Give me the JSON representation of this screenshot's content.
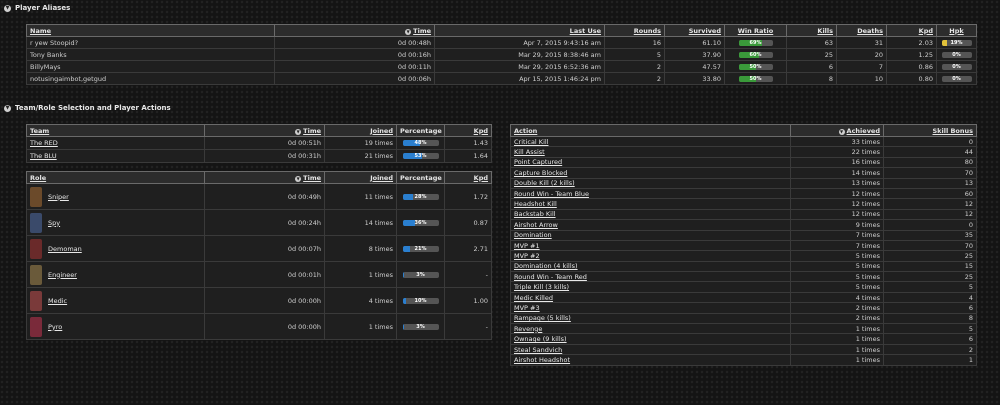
{
  "aliases": {
    "section_title": "Player Aliases",
    "headers": {
      "name": "Name",
      "time": "Time",
      "last_use": "Last Use",
      "rounds": "Rounds",
      "survived": "Survived",
      "win_ratio": "Win Ratio",
      "kills": "Kills",
      "deaths": "Deaths",
      "kpd": "Kpd",
      "hpk": "Hpk"
    },
    "rows": [
      {
        "name": "r yew Stoopid?",
        "time": "0d 00:48h",
        "last_use": "Apr 7, 2015 9:43:16 am",
        "rounds": "16",
        "survived": "61.10",
        "win_ratio": "69%",
        "win_ratio_value": 0.69,
        "kills": "63",
        "deaths": "31",
        "kpd": "2.03",
        "hpk": "19%",
        "hpk_value": 0.19
      },
      {
        "name": "Tony Banks",
        "time": "0d 00:16h",
        "last_use": "Mar 29, 2015 8:38:46 am",
        "rounds": "5",
        "survived": "37.90",
        "win_ratio": "60%",
        "win_ratio_value": 0.6,
        "kills": "25",
        "deaths": "20",
        "kpd": "1.25",
        "hpk": "0%",
        "hpk_value": 0
      },
      {
        "name": "BillyMays",
        "time": "0d 00:11h",
        "last_use": "Mar 29, 2015 6:52:36 am",
        "rounds": "2",
        "survived": "47.57",
        "win_ratio": "50%",
        "win_ratio_value": 0.5,
        "kills": "6",
        "deaths": "7",
        "kpd": "0.86",
        "hpk": "0%",
        "hpk_value": 0
      },
      {
        "name": "notusingaimbot,getgud",
        "time": "0d 00:06h",
        "last_use": "Apr 15, 2015 1:46:24 pm",
        "rounds": "2",
        "survived": "33.80",
        "win_ratio": "50%",
        "win_ratio_value": 0.5,
        "kills": "8",
        "deaths": "10",
        "kpd": "0.80",
        "hpk": "0%",
        "hpk_value": 0
      }
    ]
  },
  "team_section_title": "Team/Role Selection and Player Actions",
  "teams": {
    "headers": {
      "team": "Team",
      "time": "Time",
      "joined": "Joined",
      "percentage": "Percentage",
      "kpd": "Kpd"
    },
    "rows": [
      {
        "team": "The RED",
        "time": "0d 00:51h",
        "joined": "19 times",
        "percentage": "48%",
        "pct_value": 0.48,
        "kpd": "1.43"
      },
      {
        "team": "The BLU",
        "time": "0d 00:31h",
        "joined": "21 times",
        "percentage": "53%",
        "pct_value": 0.53,
        "kpd": "1.64"
      }
    ]
  },
  "roles": {
    "headers": {
      "role": "Role",
      "time": "Time",
      "joined": "Joined",
      "percentage": "Percentage",
      "kpd": "Kpd"
    },
    "rows": [
      {
        "role": "Sniper",
        "icon": "sniper-icon",
        "color": "#6b4a2a",
        "time": "0d 00:49h",
        "joined": "11 times",
        "percentage": "28%",
        "pct_value": 0.28,
        "kpd": "1.72"
      },
      {
        "role": "Spy",
        "icon": "spy-icon",
        "color": "#3a4a6a",
        "time": "0d 00:24h",
        "joined": "14 times",
        "percentage": "36%",
        "pct_value": 0.36,
        "kpd": "0.87"
      },
      {
        "role": "Demoman",
        "icon": "demoman-icon",
        "color": "#6a2a2a",
        "time": "0d 00:07h",
        "joined": "8 times",
        "percentage": "21%",
        "pct_value": 0.21,
        "kpd": "2.71"
      },
      {
        "role": "Engineer",
        "icon": "engineer-icon",
        "color": "#6a5a3a",
        "time": "0d 00:01h",
        "joined": "1 times",
        "percentage": "3%",
        "pct_value": 0.03,
        "kpd": "-"
      },
      {
        "role": "Medic",
        "icon": "medic-icon",
        "color": "#7a3a3a",
        "time": "0d 00:00h",
        "joined": "4 times",
        "percentage": "10%",
        "pct_value": 0.1,
        "kpd": "1.00"
      },
      {
        "role": "Pyro",
        "icon": "pyro-icon",
        "color": "#7a2a3a",
        "time": "0d 00:00h",
        "joined": "1 times",
        "percentage": "3%",
        "pct_value": 0.03,
        "kpd": "-"
      }
    ]
  },
  "actions": {
    "headers": {
      "action": "Action",
      "achieved": "Achieved",
      "skill_bonus": "Skill Bonus"
    },
    "rows": [
      {
        "action": "Critical Kill",
        "achieved": "33 times",
        "bonus": "0"
      },
      {
        "action": "Kill Assist",
        "achieved": "22 times",
        "bonus": "44"
      },
      {
        "action": "Point Captured",
        "achieved": "16 times",
        "bonus": "80"
      },
      {
        "action": "Capture Blocked",
        "achieved": "14 times",
        "bonus": "70"
      },
      {
        "action": "Double Kill (2 kills)",
        "achieved": "13 times",
        "bonus": "13"
      },
      {
        "action": "Round Win - Team Blue",
        "achieved": "12 times",
        "bonus": "60"
      },
      {
        "action": "Headshot Kill",
        "achieved": "12 times",
        "bonus": "12"
      },
      {
        "action": "Backstab Kill",
        "achieved": "12 times",
        "bonus": "12"
      },
      {
        "action": "Airshot Arrow",
        "achieved": "9 times",
        "bonus": "0"
      },
      {
        "action": "Domination",
        "achieved": "7 times",
        "bonus": "35"
      },
      {
        "action": "MVP #1",
        "achieved": "7 times",
        "bonus": "70"
      },
      {
        "action": "MVP #2",
        "achieved": "5 times",
        "bonus": "25"
      },
      {
        "action": "Domination (4 kills)",
        "achieved": "5 times",
        "bonus": "15"
      },
      {
        "action": "Round Win - Team Red",
        "achieved": "5 times",
        "bonus": "25"
      },
      {
        "action": "Triple Kill (3 kills)",
        "achieved": "5 times",
        "bonus": "5"
      },
      {
        "action": "Medic Killed",
        "achieved": "4 times",
        "bonus": "4"
      },
      {
        "action": "MVP #3",
        "achieved": "2 times",
        "bonus": "6"
      },
      {
        "action": "Rampage (5 kills)",
        "achieved": "2 times",
        "bonus": "8"
      },
      {
        "action": "Revenge",
        "achieved": "1 times",
        "bonus": "5"
      },
      {
        "action": "Ownage (9 kills)",
        "achieved": "1 times",
        "bonus": "6"
      },
      {
        "action": "Steal Sandvich",
        "achieved": "1 times",
        "bonus": "2"
      },
      {
        "action": "Airshot Headshot",
        "achieved": "1 times",
        "bonus": "1"
      }
    ]
  }
}
